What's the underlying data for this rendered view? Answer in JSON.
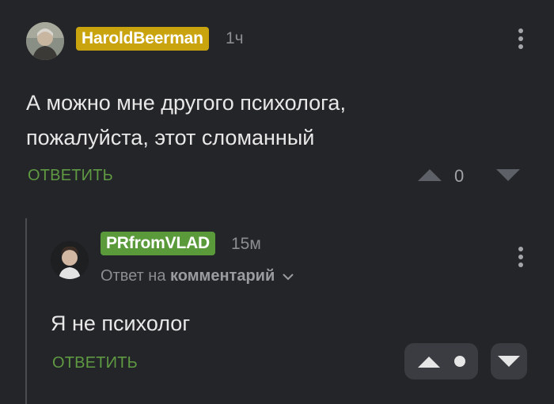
{
  "comment": {
    "author": "HaroldBeerman",
    "author_badge_color": "#c9a40f",
    "time": "1ч",
    "text_line1": "А можно мне другого психолога,",
    "text_line2": "пожалуйста, этот сломанный",
    "reply_label": "ОТВЕТИТЬ",
    "rating": "0"
  },
  "reply": {
    "author": "PRfromVLAD",
    "author_badge_color": "#5a9a3b",
    "time": "15м",
    "reply_to_prefix": "Ответ на",
    "reply_to_link": "комментарий",
    "text": "Я не психолог",
    "reply_label": "ОТВЕТИТЬ"
  },
  "icons": {
    "menu": "more-vertical-icon",
    "vote_up": "triangle-up-icon",
    "vote_down": "triangle-down-icon",
    "chevron": "chevron-down-icon"
  }
}
